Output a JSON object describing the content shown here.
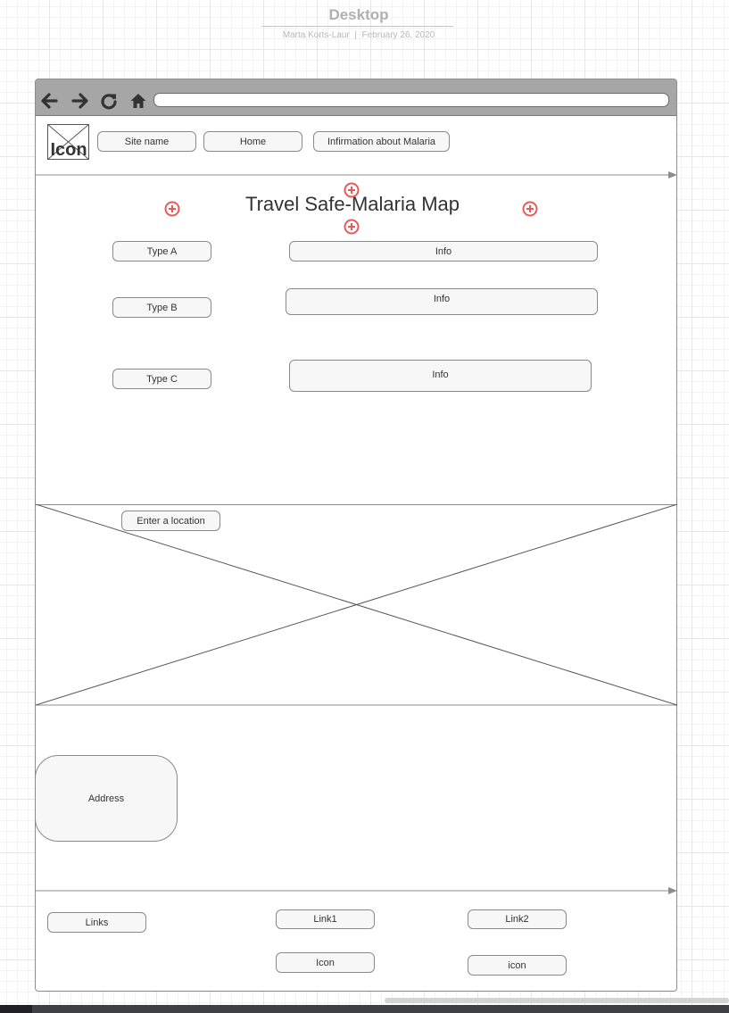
{
  "document": {
    "title": "Desktop",
    "author": "Marta Korts-Laur",
    "separator": "|",
    "date": "February 26, 2020"
  },
  "browser": {
    "toolbar_icons": [
      "back-arrow-icon",
      "forward-arrow-icon",
      "reload-icon",
      "home-icon"
    ],
    "address_value": ""
  },
  "header": {
    "logo_label": "Icon",
    "nav": {
      "site_name": "Site name",
      "home": "Home",
      "info": "Infirmation about Malaria"
    }
  },
  "main": {
    "title": "Travel Safe-Malaria Map",
    "types": [
      {
        "label": "Type A",
        "info": "Info"
      },
      {
        "label": "Type B",
        "info": "Info"
      },
      {
        "label": "Type C",
        "info": "Info"
      }
    ],
    "markers": [
      "add-marker-icon",
      "add-marker-icon",
      "add-marker-icon",
      "add-marker-icon"
    ]
  },
  "map": {
    "search_label": "Enter a location"
  },
  "address": {
    "label": "Address"
  },
  "footer": {
    "links_label": "Links",
    "link1": "Link1",
    "link2": "Link2",
    "icon1": "Icon",
    "icon2": "icon"
  },
  "colors": {
    "marker": "#e85a5a",
    "toolbar": "#a6a6a6",
    "border": "#8c8c8c",
    "button_fill": "#f7f7f7"
  }
}
